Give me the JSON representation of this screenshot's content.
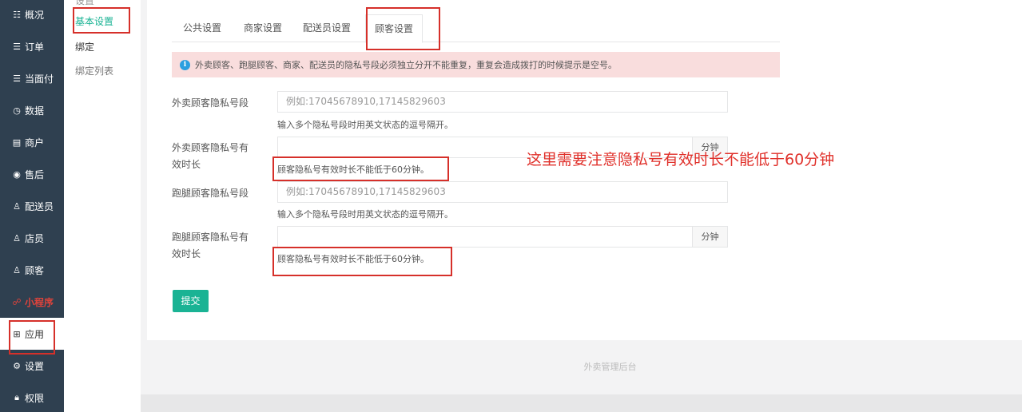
{
  "sidebar": {
    "items": [
      {
        "icon": "dashboard-icon",
        "glyph": "☷",
        "label": "概况"
      },
      {
        "icon": "orders-icon",
        "glyph": "☰",
        "label": "订单"
      },
      {
        "icon": "face-pay-icon",
        "glyph": "☰",
        "label": "当面付"
      },
      {
        "icon": "data-icon",
        "glyph": "◷",
        "label": "数据"
      },
      {
        "icon": "merchant-icon",
        "glyph": "▤",
        "label": "商户"
      },
      {
        "icon": "after-sales-icon",
        "glyph": "◉",
        "label": "售后"
      },
      {
        "icon": "courier-icon",
        "glyph": "♙",
        "label": "配送员"
      },
      {
        "icon": "clerk-icon",
        "glyph": "♙",
        "label": "店员"
      },
      {
        "icon": "customer-icon",
        "glyph": "♙",
        "label": "顾客"
      },
      {
        "icon": "mini-program-icon",
        "glyph": "☍",
        "label": "小程序"
      },
      {
        "icon": "apps-icon",
        "glyph": "⊞",
        "label": "应用"
      },
      {
        "icon": "settings-icon",
        "glyph": "⚙",
        "label": "设置"
      },
      {
        "icon": "permissions-icon",
        "glyph": "🔒︎",
        "label": "权限"
      }
    ]
  },
  "subnav": {
    "cut_label": "设置",
    "basic_settings": "基本设置",
    "binding_group": "绑定",
    "binding_list": "绑定列表"
  },
  "tabs": [
    "公共设置",
    "商家设置",
    "配送员设置",
    "顾客设置"
  ],
  "alert": {
    "icon": "info-icon",
    "text": "外卖顾客、跑腿顾客、商家、配送员的隐私号段必须独立分开不能重复，重复会造成拨打的时候提示是空号。"
  },
  "form": {
    "takeout_segment_label": "外卖顾客隐私号段",
    "takeout_segment_placeholder": "例如:17045678910,17145829603",
    "takeout_segment_help": "输入多个隐私号段时用英文状态的逗号隔开。",
    "takeout_duration_label_1": "外卖顾客隐私号有",
    "takeout_duration_label_2": "效时长",
    "takeout_duration_unit": "分钟",
    "takeout_duration_help": "顾客隐私号有效时长不能低于60分钟。",
    "errand_segment_label": "跑腿顾客隐私号段",
    "errand_segment_placeholder": "例如:17045678910,17145829603",
    "errand_segment_help": "输入多个隐私号段时用英文状态的逗号隔开。",
    "errand_duration_label_1": "跑腿顾客隐私号有",
    "errand_duration_label_2": "效时长",
    "errand_duration_unit": "分钟",
    "errand_duration_help": "顾客隐私号有效时长不能低于60分钟。",
    "submit": "提交"
  },
  "footer": "外卖管理后台",
  "annotation": "这里需要注意隐私号有效时长不能低于60分钟",
  "colors": {
    "sidebar_bg": "#2f4050",
    "accent_green": "#1ab394",
    "alert_bg": "#f9dddd",
    "highlight_red": "#d6302a"
  }
}
